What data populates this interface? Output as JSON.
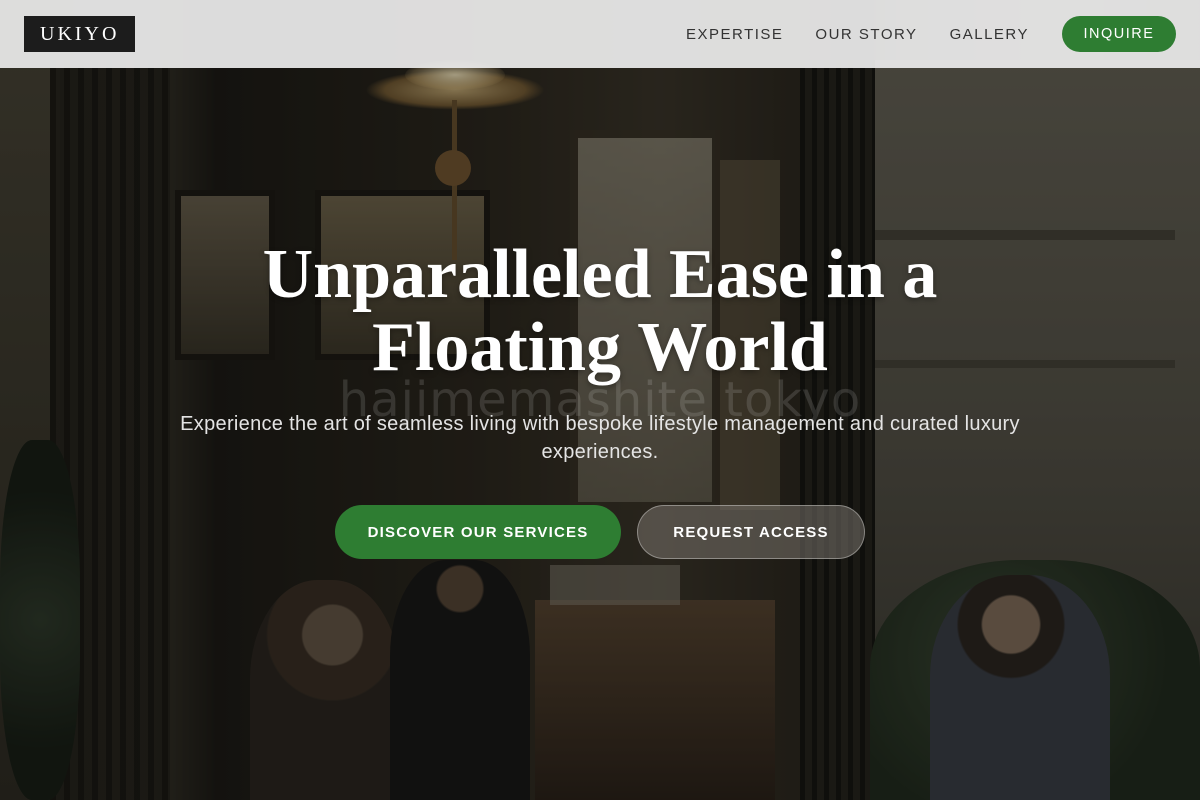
{
  "nav": {
    "logo": "UKIYO",
    "links": [
      "EXPERTISE",
      "OUR STORY",
      "GALLERY"
    ],
    "cta": "INQUIRE"
  },
  "hero": {
    "title_line1": "Unparalleled Ease in a",
    "title_line2": "Floating World",
    "subtitle": "Experience the art of seamless living with bespoke lifestyle management and curated luxury experiences.",
    "watermark": "hajimemashite tokyo",
    "primary_button": "DISCOVER OUR SERVICES",
    "secondary_button": "REQUEST ACCESS"
  },
  "colors": {
    "accent_green": "#2e7d32",
    "nav_background": "#ececec",
    "logo_background": "#1c1c1c"
  }
}
